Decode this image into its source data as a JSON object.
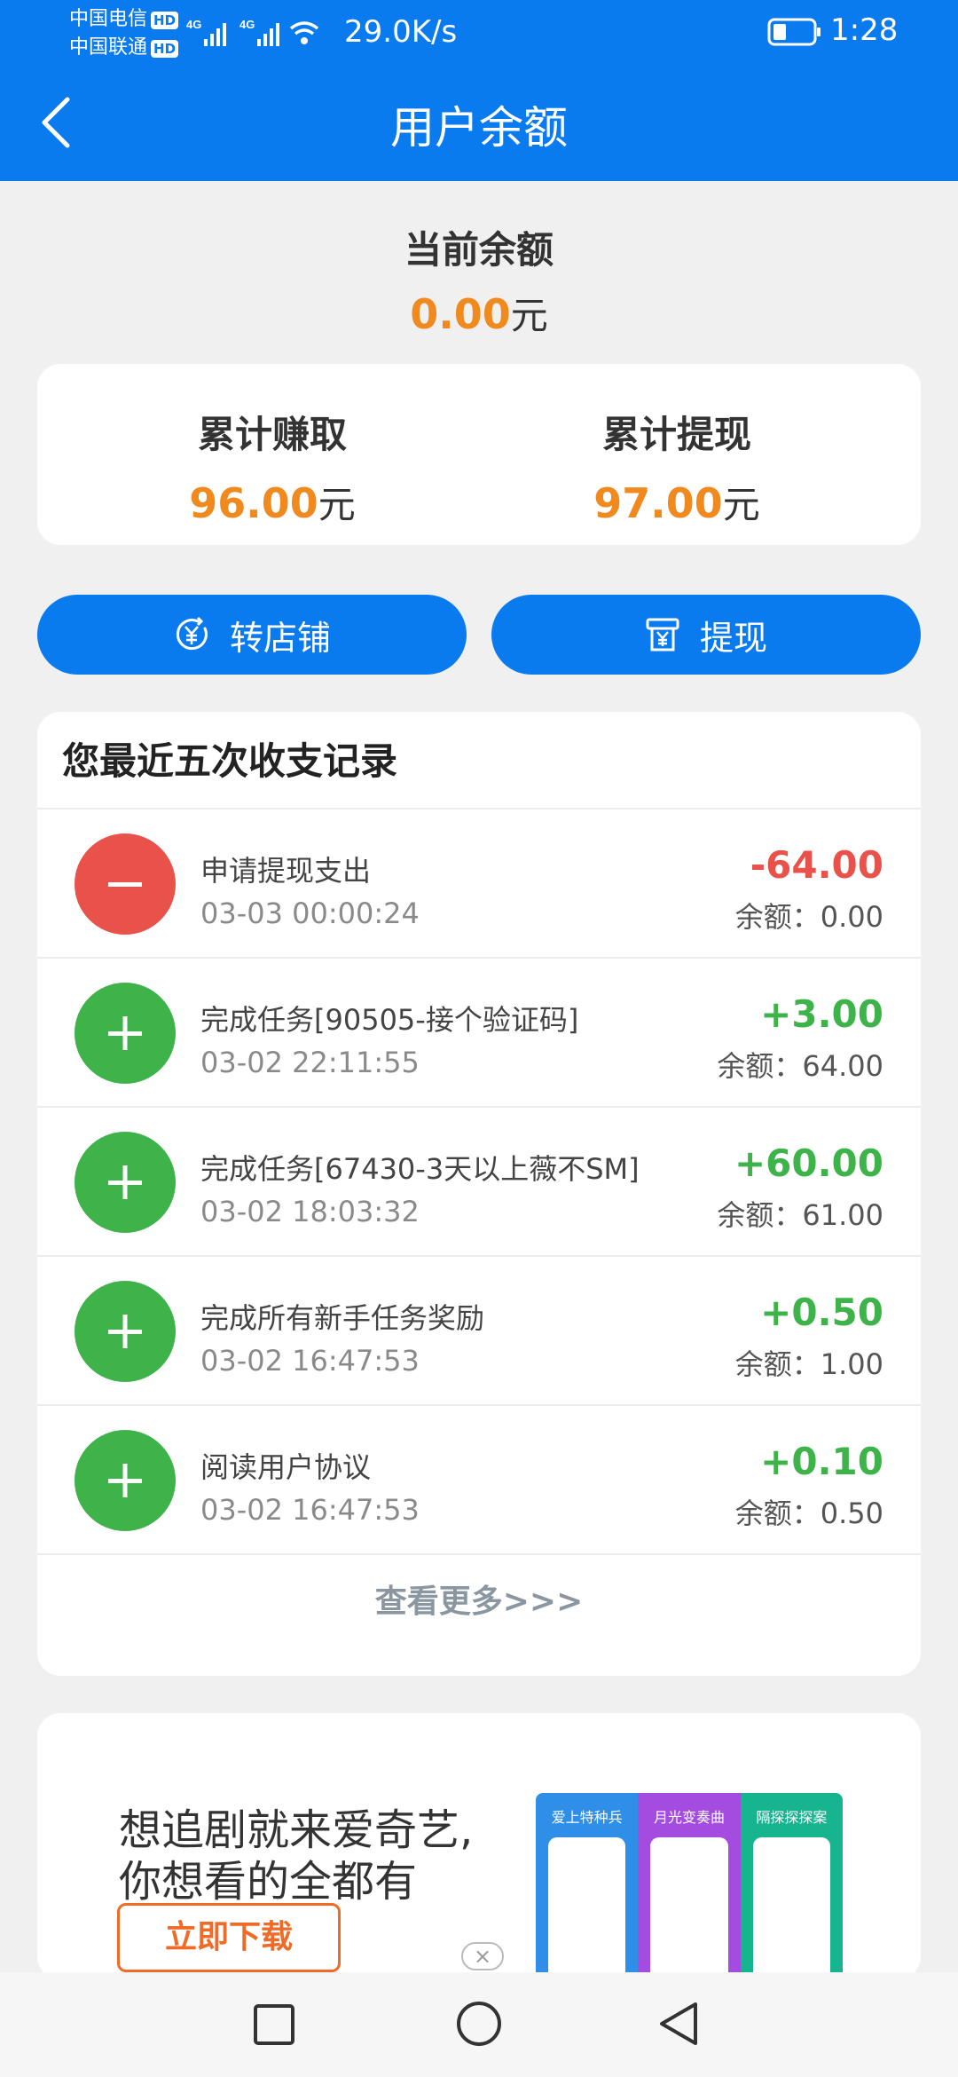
{
  "status_bar": {
    "carrier1": "中国电信",
    "carrier2": "中国联通",
    "hd_badge": "HD",
    "net1": "4G",
    "net2": "4G",
    "speed": "29.0K/s",
    "time": "1:28"
  },
  "header": {
    "title": "用户余额"
  },
  "balance": {
    "label": "当前余额",
    "amount": "0.00",
    "unit": "元"
  },
  "stats": {
    "earned_label": "累计赚取",
    "earned_amount": "96.00",
    "withdrawn_label": "累计提现",
    "withdrawn_amount": "97.00",
    "unit": "元"
  },
  "actions": {
    "transfer_label": "转店铺",
    "withdraw_label": "提现"
  },
  "records": {
    "heading": "您最近五次收支记录",
    "items": [
      {
        "type": "minus",
        "title": "申请提现支出",
        "time": "03-03 00:00:24",
        "amount": "-64.00",
        "balance": "余额：0.00"
      },
      {
        "type": "plus",
        "title": "完成任务[90505-接个验证码]",
        "time": "03-02 22:11:55",
        "amount": "+3.00",
        "balance": "余额：64.00"
      },
      {
        "type": "plus",
        "title": "完成任务[67430-3天以上薇不SM]",
        "time": "03-02 18:03:32",
        "amount": "+60.00",
        "balance": "余额：61.00"
      },
      {
        "type": "plus",
        "title": "完成所有新手任务奖励",
        "time": "03-02 16:47:53",
        "amount": "+0.50",
        "balance": "余额：1.00"
      },
      {
        "type": "plus",
        "title": "阅读用户协议",
        "time": "03-02 16:47:53",
        "amount": "+0.10",
        "balance": "余额：0.50"
      }
    ],
    "more_label": "查看更多>>>"
  },
  "ad": {
    "line1": "想追剧就来爱奇艺,",
    "line2": "你想看的全都有",
    "button_label": "立即下载",
    "close_glyph": "×",
    "panels": [
      "爱上特种兵",
      "月光变奏曲",
      "隔探探探案"
    ],
    "panel_colors": [
      "#2f8fe8",
      "#a44be0",
      "#17b58f"
    ]
  },
  "colors": {
    "primary": "#0a7bef",
    "accent": "#f08a1f",
    "positive": "#3db34a",
    "negative": "#e8524a"
  }
}
